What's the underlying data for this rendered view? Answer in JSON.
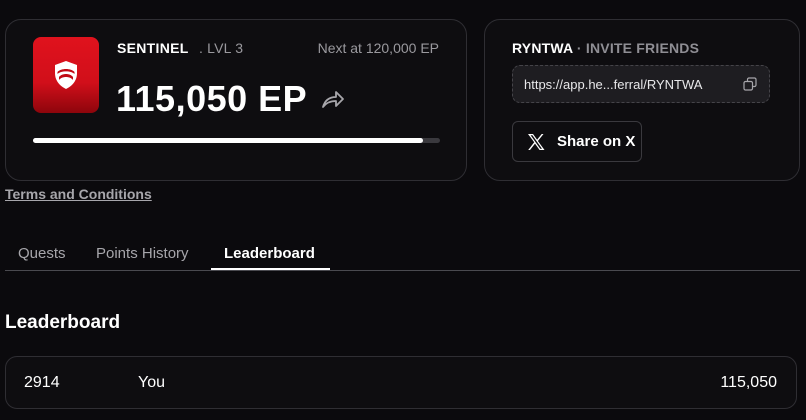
{
  "rank_card": {
    "rank_name": "SENTINEL",
    "level": ". LVL 3",
    "next_at": "Next at 120,000 EP",
    "points": "115,050 EP",
    "progress_fraction": 0.9588,
    "badge_color": "#d10f1a",
    "badge_icon": "shield-icon",
    "share_icon": "share-arrow-icon"
  },
  "invite_card": {
    "code": "RYNTWA",
    "separator": "·",
    "label": "INVITE FRIENDS",
    "link": "https://app.he...ferral/RYNTWA",
    "copy_icon": "copy-icon",
    "share_label": "Share on X",
    "share_icon": "x-logo-icon"
  },
  "terms_link": "Terms and Conditions",
  "tabs": [
    {
      "label": "Quests",
      "active": false
    },
    {
      "label": "Points History",
      "active": false
    },
    {
      "label": "Leaderboard",
      "active": true
    }
  ],
  "leaderboard": {
    "title": "Leaderboard",
    "rows": [
      {
        "rank": "2914",
        "name": "You",
        "points": "115,050"
      }
    ]
  }
}
